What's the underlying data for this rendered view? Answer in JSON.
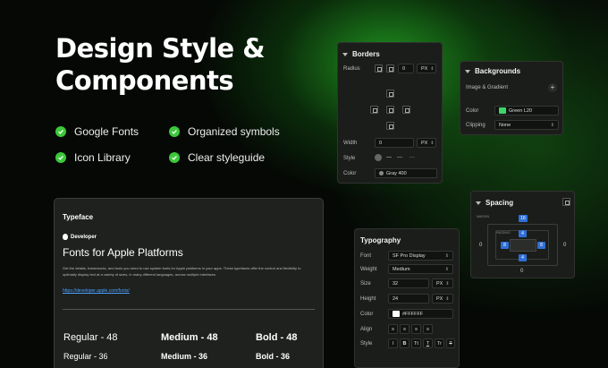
{
  "hero": {
    "title_line1": "Design Style &",
    "title_line2": "Components"
  },
  "features": [
    {
      "label": "Google Fonts"
    },
    {
      "label": "Organized symbols"
    },
    {
      "label": "Icon Library"
    },
    {
      "label": "Clear styleguide"
    }
  ],
  "colors": {
    "accent": "#3cc83c",
    "green_swatch": "#3fd46a",
    "white_swatch": "#ffffff",
    "link": "#4aa0ff"
  },
  "borders": {
    "title": "Borders",
    "radius_label": "Radius",
    "radius_value": "0",
    "radius_unit": "PX",
    "width_label": "Width",
    "width_value": "0",
    "width_unit": "PX",
    "style_label": "Style",
    "style_options": [
      "—",
      "---",
      "···"
    ],
    "color_label": "Color",
    "color_value": "Gray 400"
  },
  "backgrounds": {
    "title": "Backgrounds",
    "image_label": "Image & Gradient",
    "add_icon": "plus-icon",
    "color_label": "Color",
    "color_value": "Green L20",
    "clipping_label": "Clipping",
    "clipping_value": "None"
  },
  "spacing": {
    "title": "Spacing",
    "margin_label": "MARGIN",
    "padding_label": "PADDING",
    "margin_top": "16",
    "margin_left": "0",
    "margin_right": "0",
    "margin_bottom": "0",
    "padding_top": "4",
    "padding_left": "8",
    "padding_right": "8",
    "padding_bottom": "4"
  },
  "typography": {
    "title": "Typography",
    "font_label": "Font",
    "font_value": "SF Pro Display",
    "weight_label": "Weight",
    "weight_value": "Medium",
    "size_label": "Size",
    "size_value": "32",
    "size_unit": "PX",
    "height_label": "Height",
    "height_value": "24",
    "height_unit": "PX",
    "color_label": "Color",
    "color_value": "#FFFFFF",
    "align_label": "Align",
    "style_label": "Style",
    "style_buttons": [
      "I",
      "B",
      "Tt",
      "T",
      "Tr",
      "T"
    ]
  },
  "typeface": {
    "title": "Typeface",
    "developer": "Developer",
    "heading": "Fonts for Apple Platforms",
    "paragraph": "Get the details, frameworks, and tools you need to use system fonts for Apple platforms in your apps. These typefaces offer the control and flexibility to optimally display text at a variety of sizes, in many different languages, across multiple interfaces.",
    "link": "https://developer.apple.com/fonts/",
    "weights_48": [
      "Regular - 48",
      "Medium - 48",
      "Bold - 48"
    ],
    "weights_36": [
      "Regular - 36",
      "Medium - 36",
      "Bold - 36"
    ]
  }
}
